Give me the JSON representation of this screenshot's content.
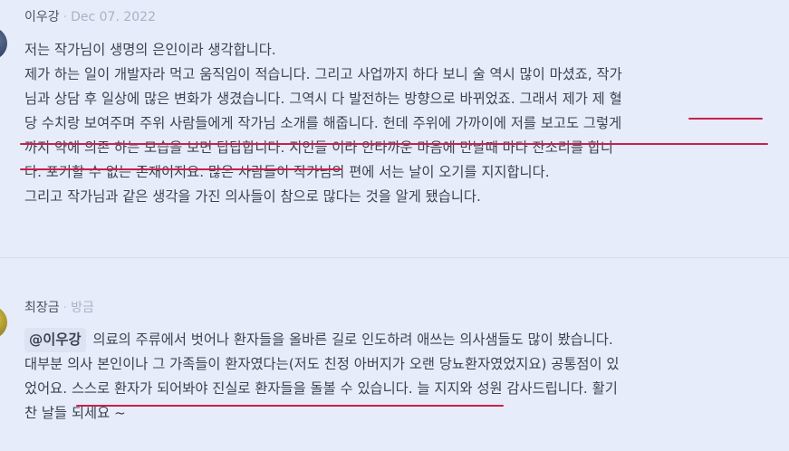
{
  "comments": [
    {
      "author": "이우강",
      "time": "Dec 07. 2022",
      "lines": [
        "저는 작가님이 생명의 은인이라 생각합니다.",
        "제가 하는 일이 개발자라 먹고 움직임이 적습니다. 그리고 사업까지 하다 보니 술 역시 많이 마셨죠, 작가",
        "님과 상담 후 일상에 많은 변화가 생겼습니다. 그역시 다 발전하는 방향으로 바뀌었죠. 그래서 제가 제 혈",
        "당 수치랑 보여주며 주위 사람들에게 작가님 소개를 해줍니다. 헌데 주위에 가까이에 저를 보고도 그렇게",
        "까지 약에 의존 하는 모습을 보면 답답합니다. 지인들 이라 안타까운 마음에 만날때 마다 잔소리를 합니",
        "다. 포기할 수 없는 존재이지요. 많은 사람들이 작가님의 편에 서는 날이 오기를 지지합니다.",
        "그리고 작가님과 같은 생각을 가진 의사들이 참으로 많다는 것을 알게 됐습니다."
      ]
    },
    {
      "author": "최장금",
      "time": "방금",
      "mention": "@이우강",
      "first_line": "의료의 주류에서 벗어나 환자들을 올바른 길로 인도하려 애쓰는 의사샘들도 많이 봤습니다.",
      "lines": [
        "대부분 의사 본인이나 그 가족들이 환자였다는(저도 친정 아버지가 오랜 당뇨환자였었지요) 공통점이 있",
        "었어요. 스스로 환자가 되어봐야 진실로 환자들을 돌볼 수 있습니다. 늘 지지와 성원 감사드립니다. 활기",
        "찬 날들 되세요 ~"
      ]
    }
  ],
  "accent_color": "#cc1f4a"
}
